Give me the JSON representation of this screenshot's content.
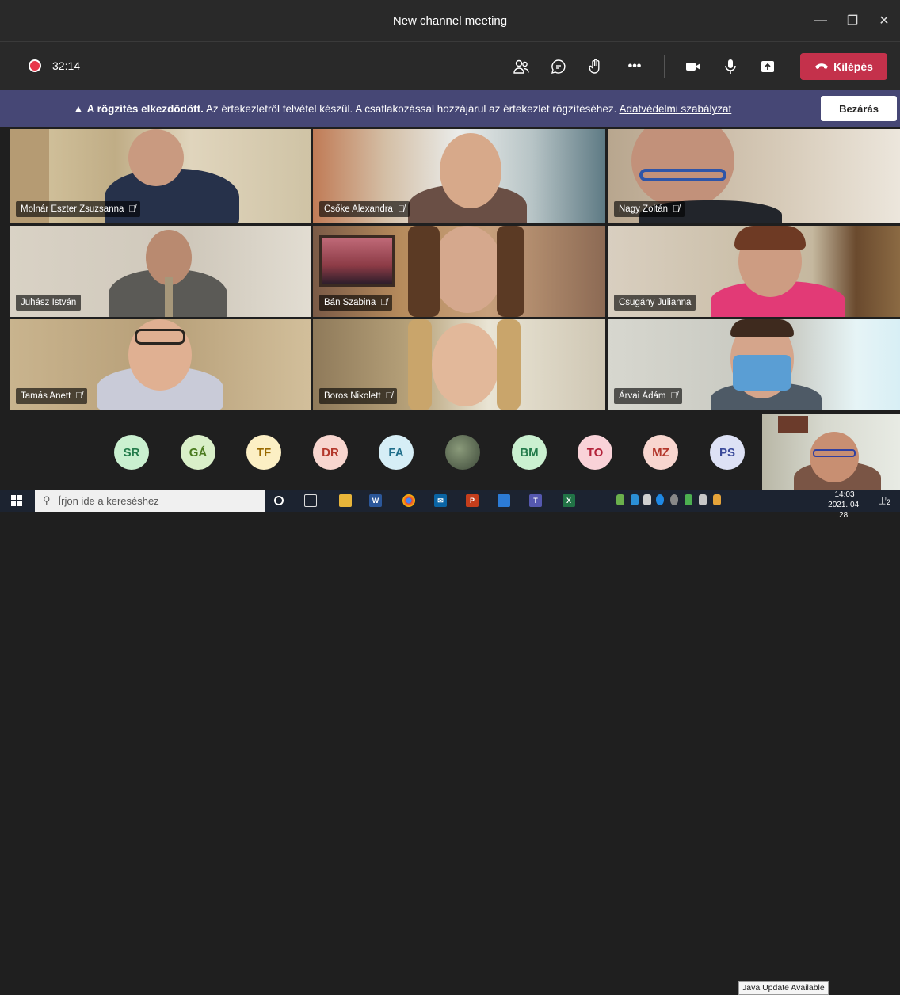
{
  "window": {
    "title": "New channel meeting"
  },
  "toolbar": {
    "timer": "32:14",
    "leave_label": "Kilépés",
    "icons": [
      "participants-icon",
      "chat-icon",
      "raise-hand-icon",
      "more-icon",
      "camera-icon",
      "mic-icon",
      "share-icon"
    ]
  },
  "banner": {
    "bold": "A rögzítés elkezdődött.",
    "text": "Az értekezletről felvétel készül. A csatlakozással hozzájárul az értekezlet rögzítéséhez.",
    "link": "Adatvédelmi szabályzat",
    "close_label": "Bezárás"
  },
  "participants": [
    {
      "name": "Molnár Eszter Zsuzsanna",
      "muted": true
    },
    {
      "name": "Csőke Alexandra",
      "muted": true
    },
    {
      "name": "Nagy Zoltán",
      "muted": true
    },
    {
      "name": "Juhász István",
      "muted": false
    },
    {
      "name": "Bán Szabina",
      "muted": true
    },
    {
      "name": "Csugány Julianna",
      "muted": false
    },
    {
      "name": "Tamás Anett",
      "muted": true
    },
    {
      "name": "Boros Nikolett",
      "muted": true
    },
    {
      "name": "Árvai Ádám",
      "muted": true
    }
  ],
  "avatars": [
    {
      "initials": "SR",
      "bg": "#caf0d0",
      "fg": "#237b4b"
    },
    {
      "initials": "GÁ",
      "bg": "#d9efc8",
      "fg": "#4a7a1e"
    },
    {
      "initials": "TF",
      "bg": "#fcefc4",
      "fg": "#9a6a00"
    },
    {
      "initials": "DR",
      "bg": "#f8d6cf",
      "fg": "#b3372b"
    },
    {
      "initials": "FA",
      "bg": "#d6eef6",
      "fg": "#1f6e8a"
    },
    {
      "initials": "",
      "bg": "#4f5d4a",
      "fg": "#ffffff"
    },
    {
      "initials": "BM",
      "bg": "#caf0d0",
      "fg": "#237b4b"
    },
    {
      "initials": "TO",
      "bg": "#f9d2d8",
      "fg": "#b3223a"
    },
    {
      "initials": "MZ",
      "bg": "#f8d6cf",
      "fg": "#b3372b"
    },
    {
      "initials": "PS",
      "bg": "#dde1f5",
      "fg": "#3b4a9b"
    }
  ],
  "taskbar": {
    "search_placeholder": "Írjon ide a kereséshez",
    "tooltip": "Java Update Available",
    "time": "14:03",
    "date": "2021. 04. 28.",
    "notification_count": "2"
  },
  "colors": {
    "banner": "#464775",
    "leave": "#c4314b",
    "record": "#e8374a"
  }
}
